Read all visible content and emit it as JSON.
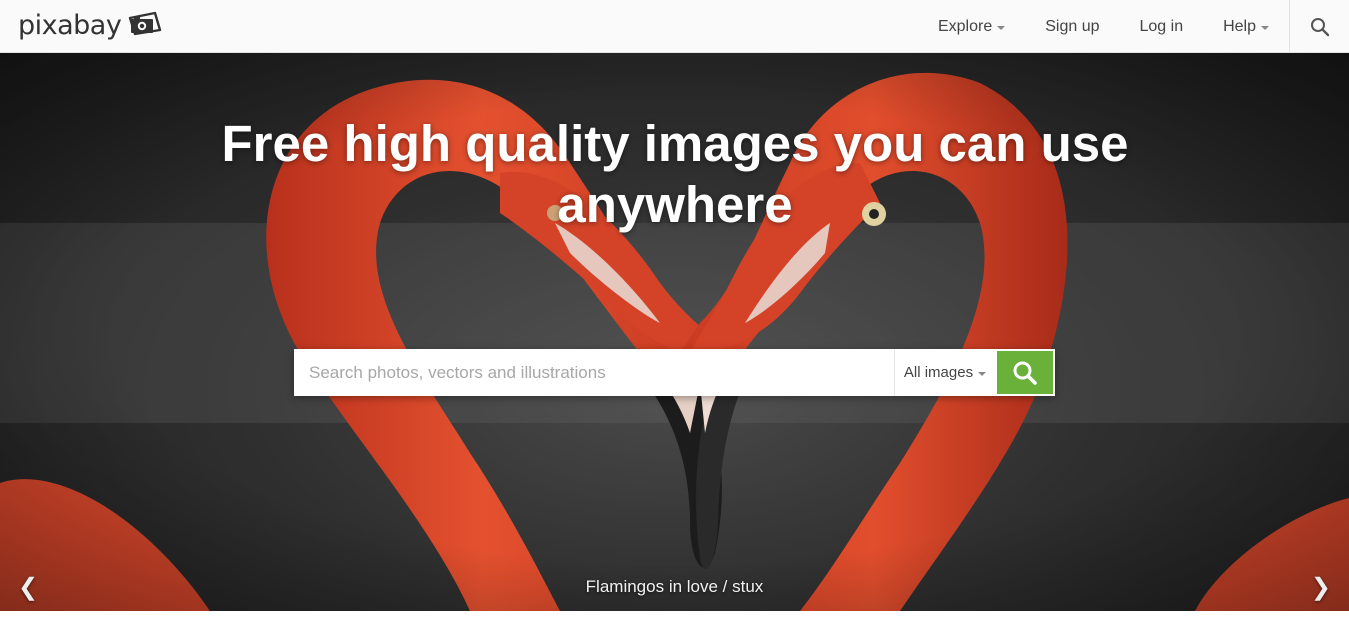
{
  "brand": {
    "name": "pixabay",
    "logo_icon": "camera-icon"
  },
  "nav": {
    "explore": "Explore",
    "signup": "Sign up",
    "login": "Log in",
    "help": "Help",
    "search_icon": "search-icon"
  },
  "hero": {
    "title": "Free high quality images you can use anywhere",
    "search": {
      "placeholder": "Search photos, vectors and illustrations",
      "value": "",
      "type_selected": "All images",
      "button_icon": "search-icon",
      "button_color": "#6ab13a"
    },
    "caption": "Flamingos in love / stux",
    "prev_arrow": "❮",
    "next_arrow": "❯"
  },
  "colors": {
    "flamingo": "#e0482b",
    "accent": "#6ab13a",
    "topbar": "#fafafa"
  }
}
